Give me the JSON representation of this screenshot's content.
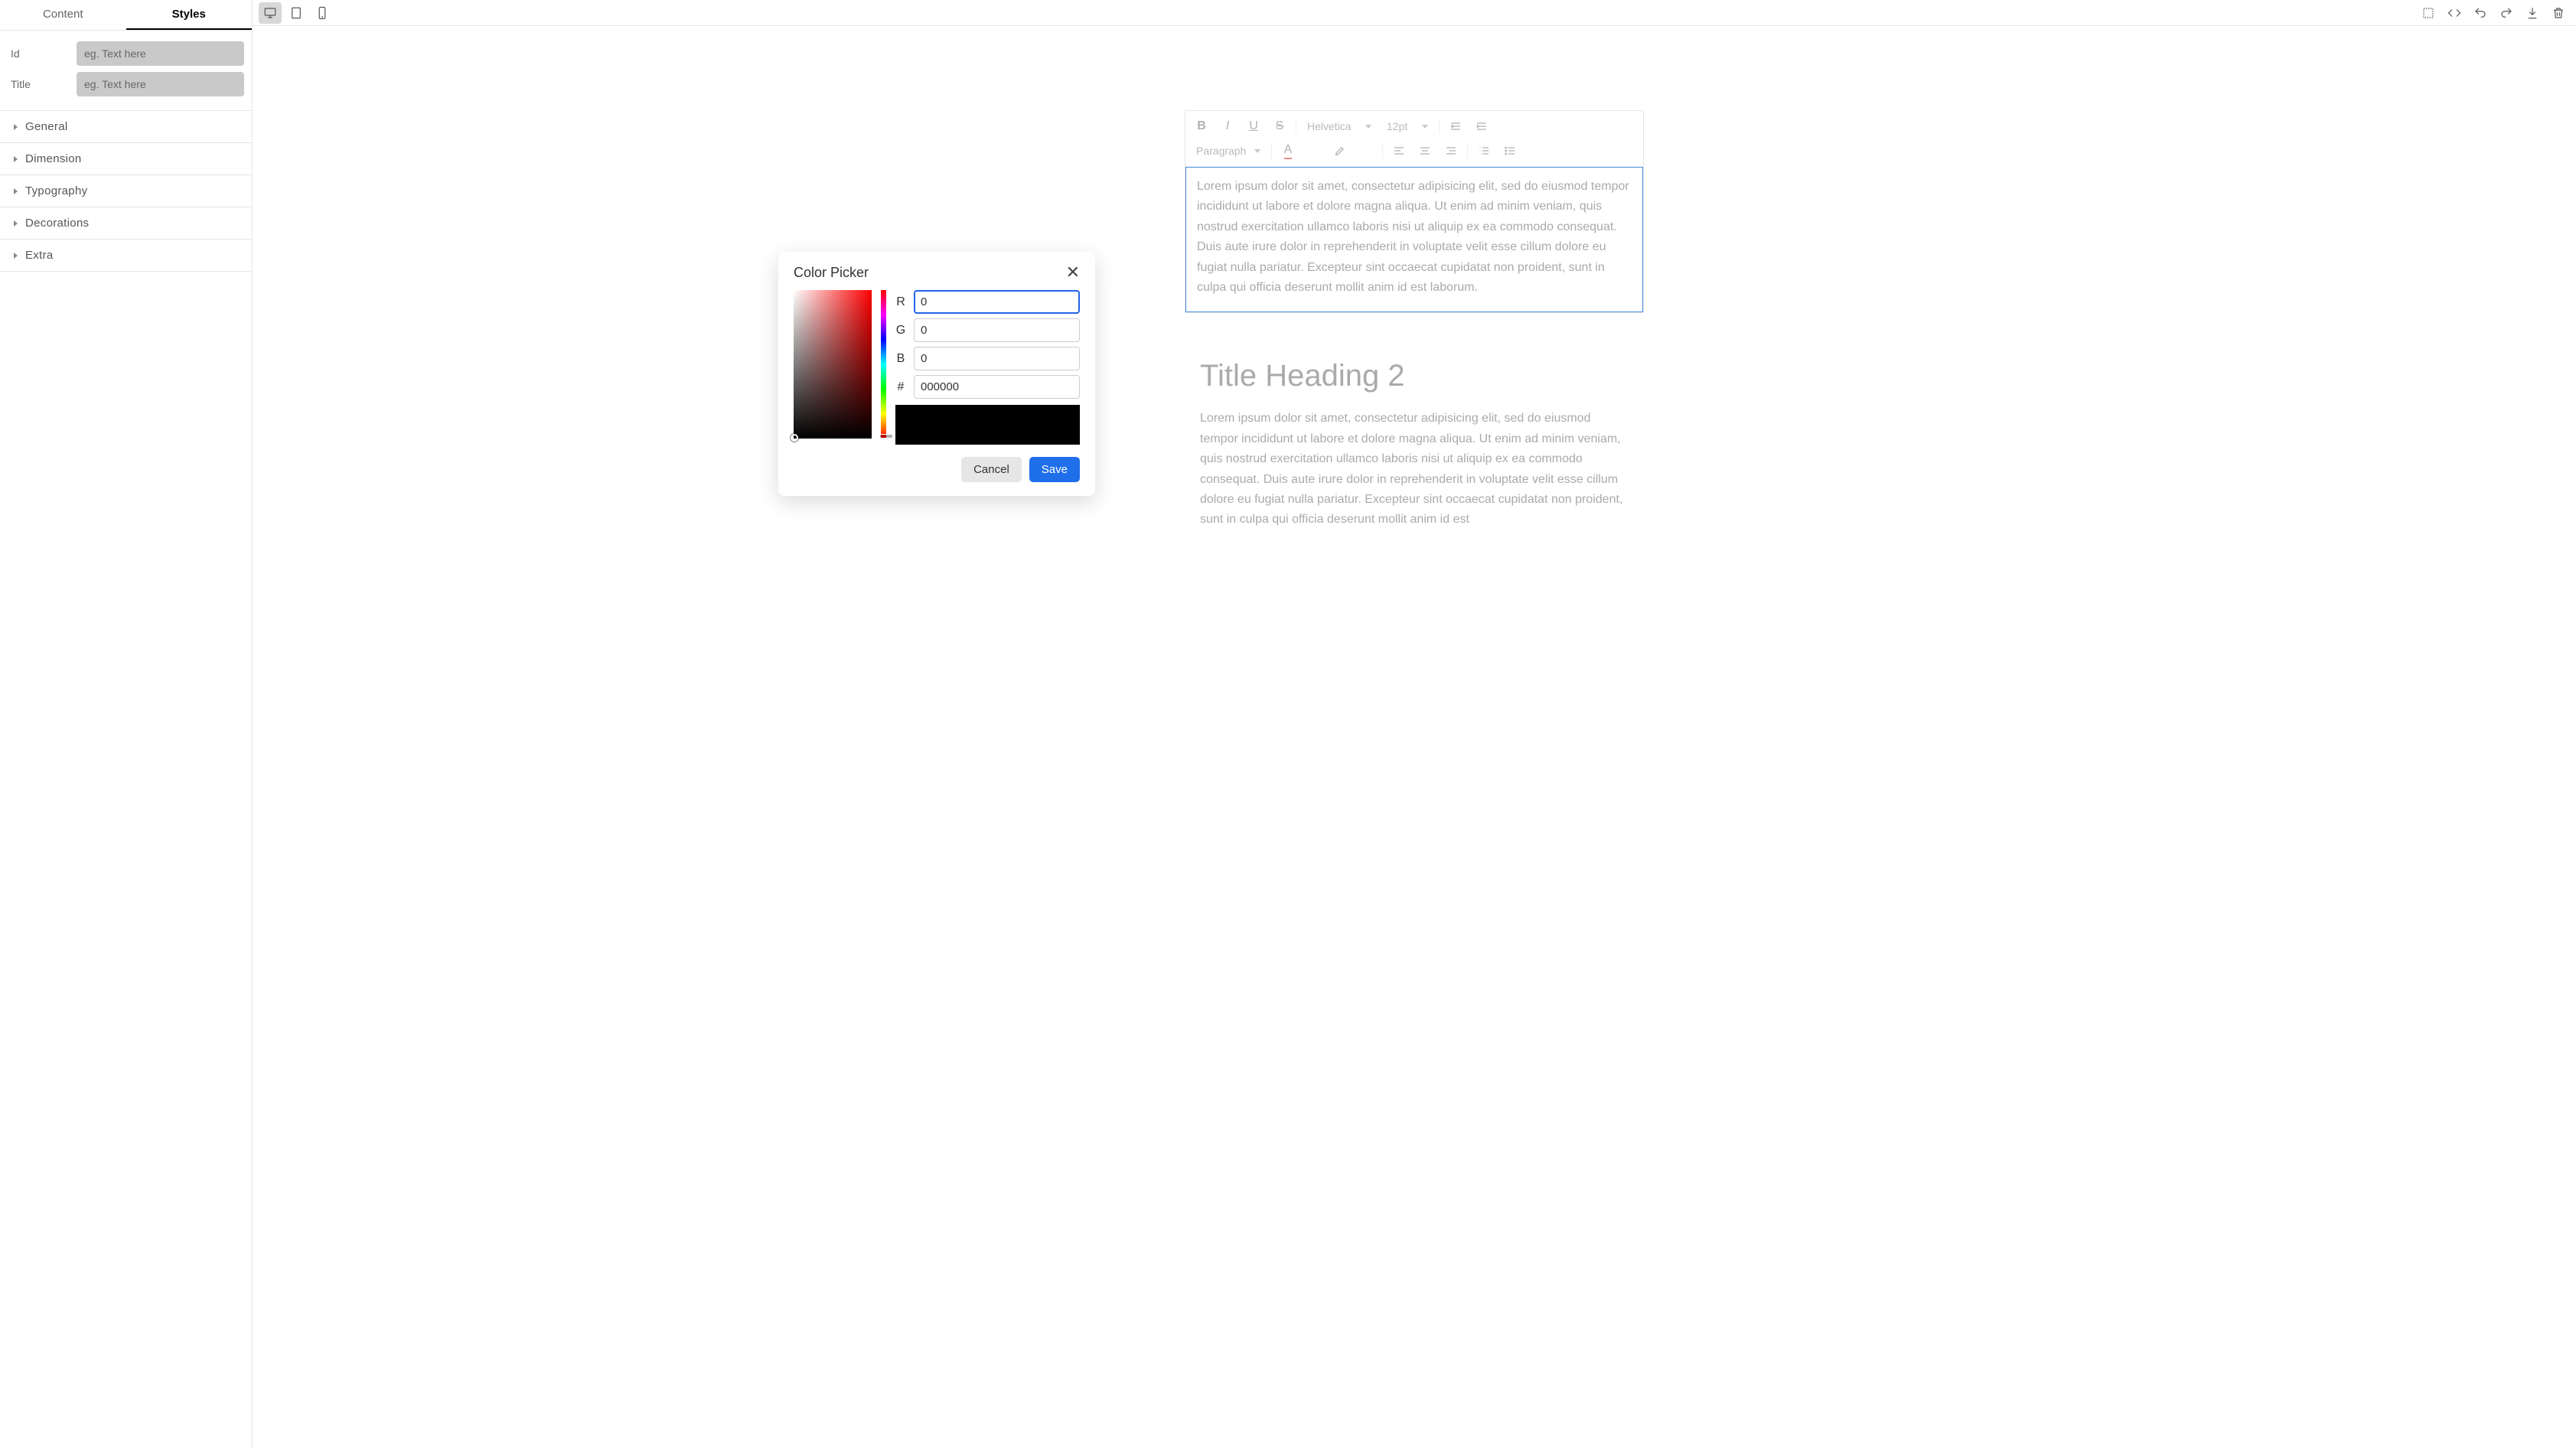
{
  "sidebar": {
    "tabs": {
      "content": "Content",
      "styles": "Styles"
    },
    "fields": {
      "id_label": "Id",
      "id_value": "",
      "id_placeholder": "eg. Text here",
      "title_label": "Title",
      "title_value": "",
      "title_placeholder": "eg. Text here"
    },
    "accordion": [
      "General",
      "Dimension",
      "Typography",
      "Decorations",
      "Extra"
    ]
  },
  "editor_toolbar": {
    "font": "Helvetica",
    "size": "12pt",
    "block": "Paragraph"
  },
  "block1": {
    "text": "Lorem ipsum dolor sit amet, consectetur adipisicing elit, sed do eiusmod tempor incididunt ut labore et dolore magna aliqua. Ut enim ad minim veniam, quis nostrud exercitation ullamco laboris nisi ut aliquip ex ea commodo consequat. Duis aute irure dolor in reprehenderit in voluptate velit esse cillum dolore eu fugiat nulla pariatur. Excepteur sint occaecat cupidatat non proident, sunt in culpa qui officia deserunt mollit anim id est laborum."
  },
  "block2": {
    "heading": "Title Heading 2",
    "text": "Lorem ipsum dolor sit amet, consectetur adipisicing elit, sed do eiusmod tempor incididunt ut labore et dolore magna aliqua. Ut enim ad minim veniam, quis nostrud exercitation ullamco laboris nisi ut aliquip ex ea commodo consequat. Duis aute irure dolor in reprehenderit in voluptate velit esse cillum dolore eu fugiat nulla pariatur. Excepteur sint occaecat cupidatat non proident, sunt in culpa qui officia deserunt mollit anim id est"
  },
  "color_picker": {
    "title": "Color Picker",
    "r_label": "R",
    "r_value": "0",
    "g_label": "G",
    "g_value": "0",
    "b_label": "B",
    "b_value": "0",
    "hex_label": "#",
    "hex_value": "000000",
    "swatch": "#000000",
    "cancel": "Cancel",
    "save": "Save"
  }
}
